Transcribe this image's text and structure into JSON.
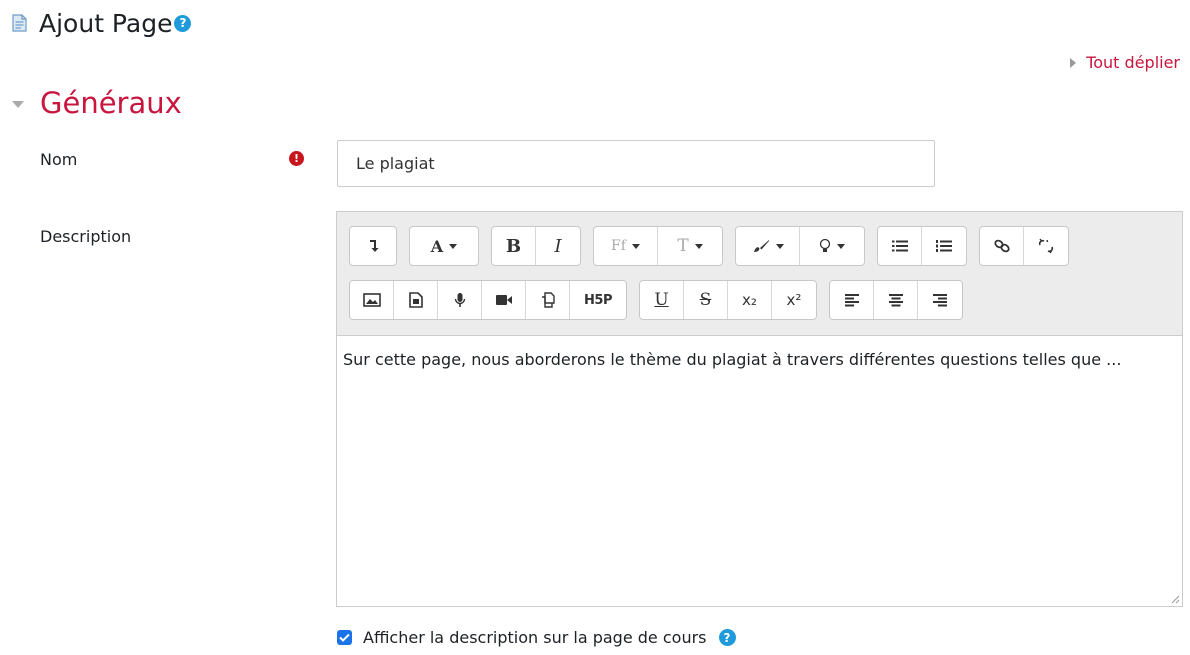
{
  "header": {
    "title": "Ajout Page",
    "help_icon": "?"
  },
  "expand_all": {
    "label": "Tout déplier"
  },
  "section": {
    "title": "Généraux"
  },
  "form": {
    "name": {
      "label": "Nom",
      "required_icon": "!",
      "value": "Le plagiat"
    },
    "description": {
      "label": "Description",
      "content": "Sur cette page, nous aborderons le thème du plagiat à travers différentes questions telles que ..."
    },
    "show_description": {
      "label": "Afficher la description sur la page de cours",
      "checked": true,
      "help_icon": "?"
    }
  },
  "toolbar": {
    "row1": [
      {
        "name": "collapse-button",
        "icon": "collapse-icon"
      },
      {
        "name": "style-dropdown",
        "text": "A"
      },
      {
        "name": "bold-button",
        "text": "B"
      },
      {
        "name": "italic-button",
        "text": "I"
      },
      {
        "name": "font-family-dropdown",
        "text": "Ff"
      },
      {
        "name": "font-size-dropdown",
        "text": "T"
      },
      {
        "name": "text-color-dropdown",
        "icon": "brush-icon"
      },
      {
        "name": "background-color-dropdown",
        "icon": "bulb-icon"
      },
      {
        "name": "unordered-list-button",
        "icon": "unordered-list-icon"
      },
      {
        "name": "ordered-list-button",
        "icon": "ordered-list-icon"
      },
      {
        "name": "link-button",
        "icon": "link-icon"
      },
      {
        "name": "unlink-button",
        "icon": "unlink-icon"
      }
    ],
    "row2": [
      {
        "name": "image-button",
        "icon": "image-icon"
      },
      {
        "name": "media-button",
        "icon": "media-icon"
      },
      {
        "name": "audio-record-button",
        "icon": "microphone-icon"
      },
      {
        "name": "video-record-button",
        "icon": "video-camera-icon"
      },
      {
        "name": "manage-files-button",
        "icon": "copy-icon"
      },
      {
        "name": "h5p-button",
        "text": "H5P"
      },
      {
        "name": "underline-button",
        "text": "U"
      },
      {
        "name": "strikethrough-button",
        "text": "S"
      },
      {
        "name": "subscript-button",
        "text": "x₂"
      },
      {
        "name": "superscript-button",
        "text": "x²"
      },
      {
        "name": "align-left-button",
        "icon": "align-left-icon"
      },
      {
        "name": "align-center-button",
        "icon": "align-center-icon"
      },
      {
        "name": "align-right-button",
        "icon": "align-right-icon"
      }
    ]
  },
  "colors": {
    "accent": "#c8163e",
    "help": "#1f9bdb",
    "required": "#c8161f",
    "checkbox": "#1a73e8"
  }
}
